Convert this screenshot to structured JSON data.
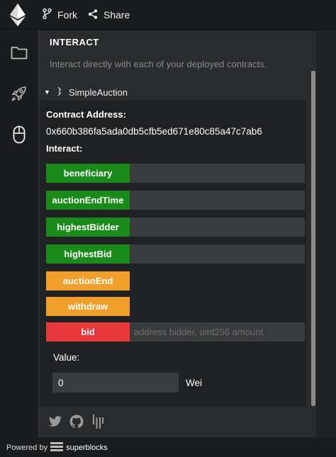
{
  "topbar": {
    "fork_label": "Fork",
    "share_label": "Share"
  },
  "panel": {
    "title": "INTERACT",
    "description": "Interact directly with each of your deployed contracts."
  },
  "contract": {
    "name": "SimpleAuction",
    "address_label": "Contract Address:",
    "address": "0x660b386fa5ada0db5cfb5ed671e80c85a47c7ab6",
    "interact_label": "Interact:",
    "functions": [
      {
        "label": "beneficiary",
        "kind": "view"
      },
      {
        "label": "auctionEndTime",
        "kind": "view"
      },
      {
        "label": "highestBidder",
        "kind": "view"
      },
      {
        "label": "highestBid",
        "kind": "view"
      },
      {
        "label": "auctionEnd",
        "kind": "transact"
      },
      {
        "label": "withdraw",
        "kind": "transact"
      },
      {
        "label": "bid",
        "kind": "payable",
        "placeholder": "address bidder, uint256 amount"
      }
    ],
    "value_label": "Value:",
    "value": "0",
    "unit": "Wei"
  },
  "footer": {
    "powered_by": "Powered by",
    "brand": "superblocks"
  },
  "colors": {
    "view": "#1a8a1a",
    "transact": "#f0a02a",
    "payable": "#e8383b",
    "panel_bg": "#2a2b2d",
    "app_bg": "#1b1c1e"
  }
}
